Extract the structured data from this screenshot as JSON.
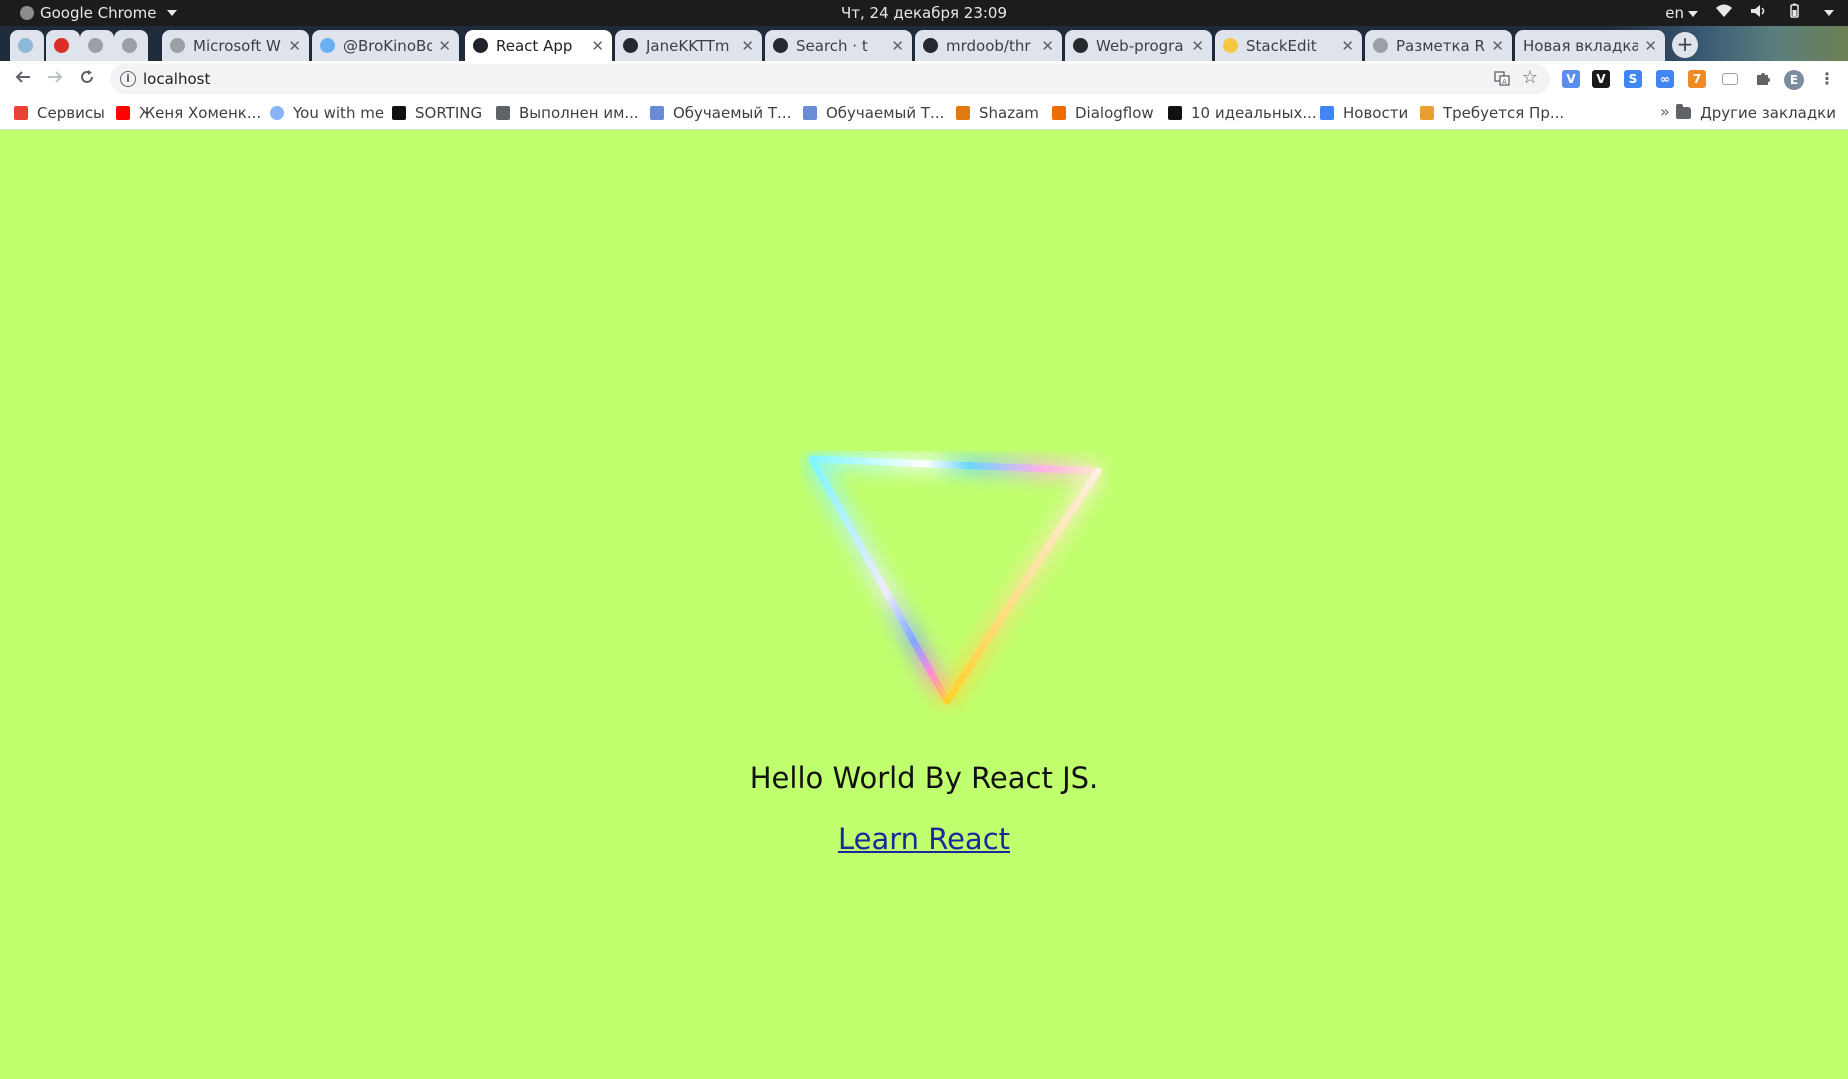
{
  "system_bar": {
    "app_name": "Google Chrome",
    "datetime": "Чт, 24 декабря  23:09",
    "language": "en"
  },
  "tabs": [
    {
      "title": "",
      "favicon_color": "#8fb8d8"
    },
    {
      "title": "",
      "favicon_color": "#d93025"
    },
    {
      "title": "",
      "favicon_color": "#9aa0a6"
    },
    {
      "title": "",
      "favicon_color": "#9aa0a6"
    },
    {
      "title": "Microsoft W",
      "favicon_color": "#9aa0a6"
    },
    {
      "title": "@BroKinoBo",
      "favicon_color": "#6ab0f5"
    },
    {
      "title": "React App",
      "favicon_color": "#20232a",
      "active": true
    },
    {
      "title": "JaneKKTTm",
      "favicon_color": "#24292e"
    },
    {
      "title": "Search · t",
      "favicon_color": "#24292e"
    },
    {
      "title": "mrdoob/thr",
      "favicon_color": "#24292e"
    },
    {
      "title": "Web-progra",
      "favicon_color": "#24292e"
    },
    {
      "title": "StackEdit",
      "favicon_color": "#f5c842"
    },
    {
      "title": "Разметка RE",
      "favicon_color": "#9aa0a6"
    },
    {
      "title": "Новая вкладка",
      "favicon_color": ""
    }
  ],
  "toolbar": {
    "url": "localhost"
  },
  "bookmarks": [
    {
      "label": "Сервисы",
      "icon_color": "#ea4335"
    },
    {
      "label": "Женя Хоменк...",
      "icon_color": "#ff0000"
    },
    {
      "label": "You with me",
      "icon_color": "#8ab4f8"
    },
    {
      "label": "SORTING",
      "icon_color": "#111111"
    },
    {
      "label": "Выполнен им...",
      "icon_color": "#5f6368"
    },
    {
      "label": "Обучаемый Т...",
      "icon_color": "#6a8cd8"
    },
    {
      "label": "Обучаемый Т...",
      "icon_color": "#6a8cd8"
    },
    {
      "label": "Shazam",
      "icon_color": "#e07a10"
    },
    {
      "label": "Dialogflow",
      "icon_color": "#ef6c00"
    },
    {
      "label": "10 идеальных...",
      "icon_color": "#111111"
    },
    {
      "label": "Новости",
      "icon_color": "#4285f4"
    },
    {
      "label": "Требуется Пр...",
      "icon_color": "#e8a030"
    }
  ],
  "bookmarks_more": "»",
  "bookmarks_other": "Другие закладки",
  "extensions": [
    {
      "label": "V",
      "color": "#5b8def"
    },
    {
      "label": "V",
      "color": "#1a1a1a"
    },
    {
      "label": "S",
      "color": "#4285f4"
    },
    {
      "label": "∞",
      "color": "#4285f4"
    },
    {
      "label": "7",
      "color": "#f08a24"
    }
  ],
  "profile_initial": "E",
  "content": {
    "heading": "Hello World By React JS.",
    "link": "Learn React",
    "background": "#c0ff6e"
  }
}
